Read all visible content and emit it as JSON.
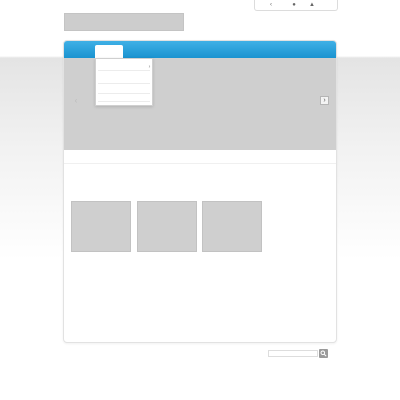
{
  "header": {
    "logo_text": "",
    "utility_icons": [
      {
        "name": "back-icon",
        "glyph": "‹"
      },
      {
        "name": "cart-icon",
        "glyph": "●"
      },
      {
        "name": "account-icon",
        "glyph": "▲"
      }
    ]
  },
  "nav": {
    "accent_color": "#1a93d0",
    "active_tab_label": ""
  },
  "dropdown": {
    "items": [
      "",
      "",
      "",
      ""
    ]
  },
  "slider": {
    "prev_glyph": "‹",
    "next_glyph": "›"
  },
  "thumbnails": [
    "",
    "",
    ""
  ],
  "search": {
    "placeholder": "",
    "button_icon": "search-icon"
  }
}
